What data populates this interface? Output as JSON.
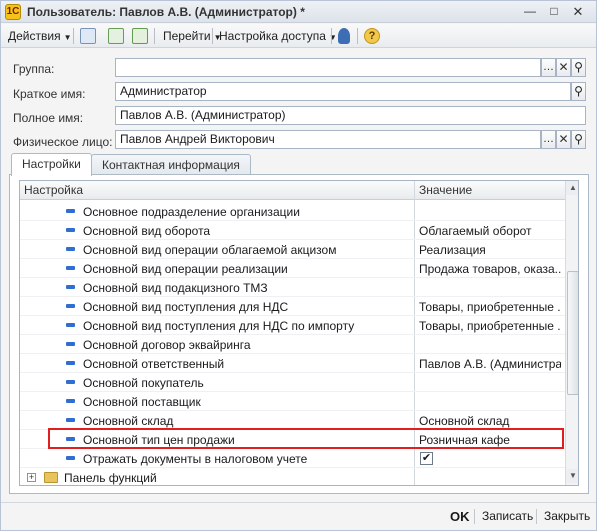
{
  "window": {
    "title": "Пользователь: Павлов А.В. (Администратор) *",
    "app_icon_glyph": "1С"
  },
  "toolbar": {
    "actions": "Действия",
    "go": "Перейти",
    "access": "Настройка доступа",
    "help": "?"
  },
  "fields": {
    "group": {
      "label": "Группа:",
      "value": ""
    },
    "short_name": {
      "label": "Краткое имя:",
      "value": "Администратор"
    },
    "full_name": {
      "label": "Полное имя:",
      "value": "Павлов А.В. (Администратор)"
    },
    "person": {
      "label": "Физическое лицо:",
      "value": "Павлов Андрей Викторович"
    }
  },
  "tabs": [
    {
      "label": "Настройки",
      "active": true
    },
    {
      "label": "Контактная информация",
      "active": false
    }
  ],
  "grid": {
    "headers": {
      "setting": "Настройка",
      "value": "Значение"
    },
    "rows": [
      {
        "name": "Основное подразделение организации",
        "value": ""
      },
      {
        "name": "Основной вид оборота",
        "value": "Облагаемый оборот"
      },
      {
        "name": "Основной вид операции облагаемой акцизом",
        "value": "Реализация"
      },
      {
        "name": "Основной вид операции реализации",
        "value": "Продажа товаров, оказа..."
      },
      {
        "name": "Основной вид подакцизного ТМЗ",
        "value": ""
      },
      {
        "name": "Основной вид поступления для НДС",
        "value": "Товары, приобретенные ..."
      },
      {
        "name": "Основной вид поступления для НДС по импорту",
        "value": "Товары, приобретенные ..."
      },
      {
        "name": "Основной договор эквайринга",
        "value": ""
      },
      {
        "name": "Основной ответственный",
        "value": "Павлов А.В. (Администра..."
      },
      {
        "name": "Основной покупатель",
        "value": ""
      },
      {
        "name": "Основной поставщик",
        "value": ""
      },
      {
        "name": "Основной склад",
        "value": "Основной склад"
      },
      {
        "name": "Основной тип цен продажи",
        "value": "Розничная кафе"
      }
    ],
    "checkbox_row": {
      "name": "Отражать документы в налоговом учете",
      "checked": true
    },
    "folder_row": {
      "name": "Панель функций"
    }
  },
  "footer": {
    "ok": "OK",
    "save": "Записать",
    "close": "Закрыть"
  },
  "colors": {
    "highlight": "#e02020",
    "row_icon": "#2f6fd1"
  }
}
